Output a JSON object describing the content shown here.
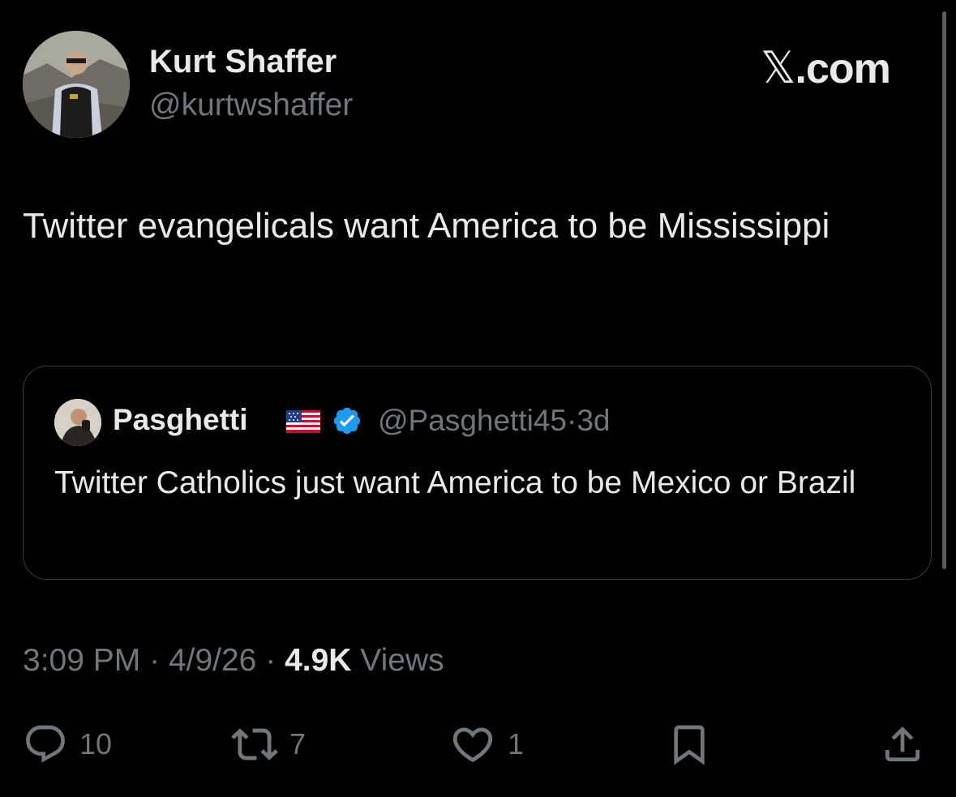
{
  "brand": {
    "prefix": "𝕏",
    "suffix": ".com"
  },
  "author": {
    "name": "Kurt Shaffer",
    "handle": "@kurtwshaffer",
    "avatar_icon": "profile-photo"
  },
  "tweet": {
    "text": "Twitter evangelicals want America to be Mississippi"
  },
  "quoted": {
    "name": "Pasghetti",
    "flag_icon": "us-flag",
    "verified_icon": "verified-badge",
    "handle": "@Pasghetti45",
    "separator": "·",
    "age": "3d",
    "text": "Twitter Catholics just want America to be Mexico or Brazil"
  },
  "meta": {
    "time": "3:09 PM",
    "separator": "·",
    "date": "4/9/26",
    "views_count": "4.9K",
    "views_label": "Views"
  },
  "actions": {
    "reply_count": "10",
    "retweet_count": "7",
    "like_count": "1"
  },
  "colors": {
    "background": "#000000",
    "primary_text": "#e7e9ea",
    "secondary_text": "#71767b",
    "border": "#3a3d41",
    "verified": "#1d9bf0"
  }
}
